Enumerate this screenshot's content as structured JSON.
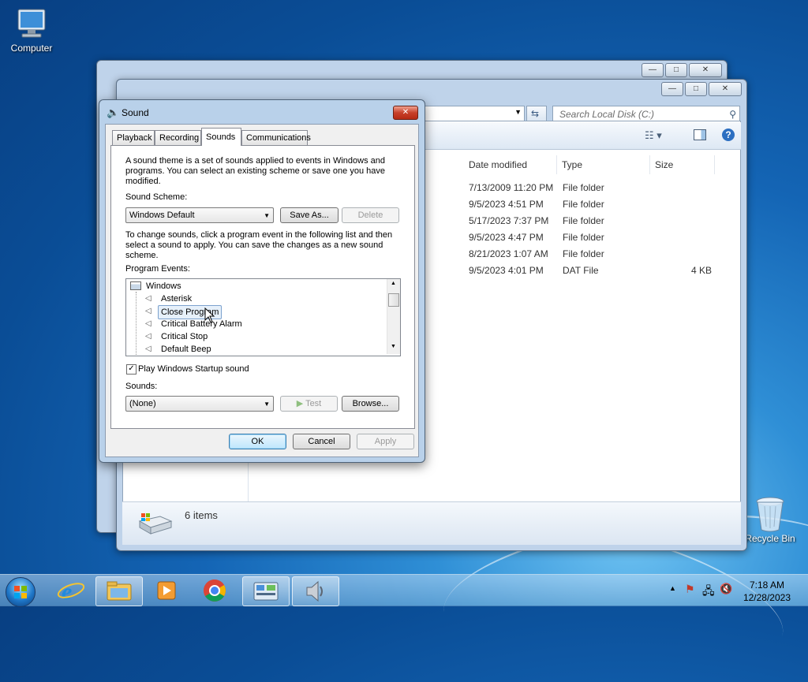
{
  "desktop": {
    "computer_label": "Computer",
    "recycle_label": "Recycle Bin"
  },
  "explorer": {
    "search_placeholder": "Search Local Disk (C:)",
    "columns": [
      "Date modified",
      "Type",
      "Size"
    ],
    "rows": [
      {
        "date": "7/13/2009 11:20 PM",
        "type": "File folder",
        "size": ""
      },
      {
        "date": "9/5/2023 4:51 PM",
        "type": "File folder",
        "size": ""
      },
      {
        "date": "5/17/2023 7:37 PM",
        "type": "File folder",
        "size": ""
      },
      {
        "date": "9/5/2023 4:47 PM",
        "type": "File folder",
        "size": ""
      },
      {
        "date": "8/21/2023 1:07 AM",
        "type": "File folder",
        "size": ""
      },
      {
        "date": "9/5/2023 4:01 PM",
        "type": "DAT File",
        "size": "4 KB"
      }
    ],
    "item_count": "6 items"
  },
  "sound": {
    "title": "Sound",
    "tabs": [
      "Playback",
      "Recording",
      "Sounds",
      "Communications"
    ],
    "active_tab": "Sounds",
    "intro": "A sound theme is a set of sounds applied to events in Windows and programs.  You can select an existing scheme or save one you have modified.",
    "scheme_label": "Sound Scheme:",
    "scheme_value": "Windows Default",
    "save_as": "Save As...",
    "delete": "Delete",
    "instructions": "To change sounds, click a program event in the following list and then select a sound to apply.  You can save the changes as a new sound scheme.",
    "events_label": "Program Events:",
    "events_root": "Windows",
    "events": [
      "Asterisk",
      "Close Program",
      "Critical Battery Alarm",
      "Critical Stop",
      "Default Beep"
    ],
    "selected_event": "Close Program",
    "startup_label": "Play Windows Startup sound",
    "sounds_label": "Sounds:",
    "sound_value": "(None)",
    "test": "Test",
    "browse": "Browse...",
    "ok": "OK",
    "cancel": "Cancel",
    "apply": "Apply"
  },
  "taskbar": {
    "time": "7:18 AM",
    "date": "12/28/2023"
  },
  "icons": [
    "computer-icon",
    "recycle-bin-icon",
    "start-orb-icon",
    "ie-icon",
    "explorer-icon",
    "media-player-icon",
    "chrome-icon",
    "control-panel-icon",
    "sound-icon"
  ]
}
